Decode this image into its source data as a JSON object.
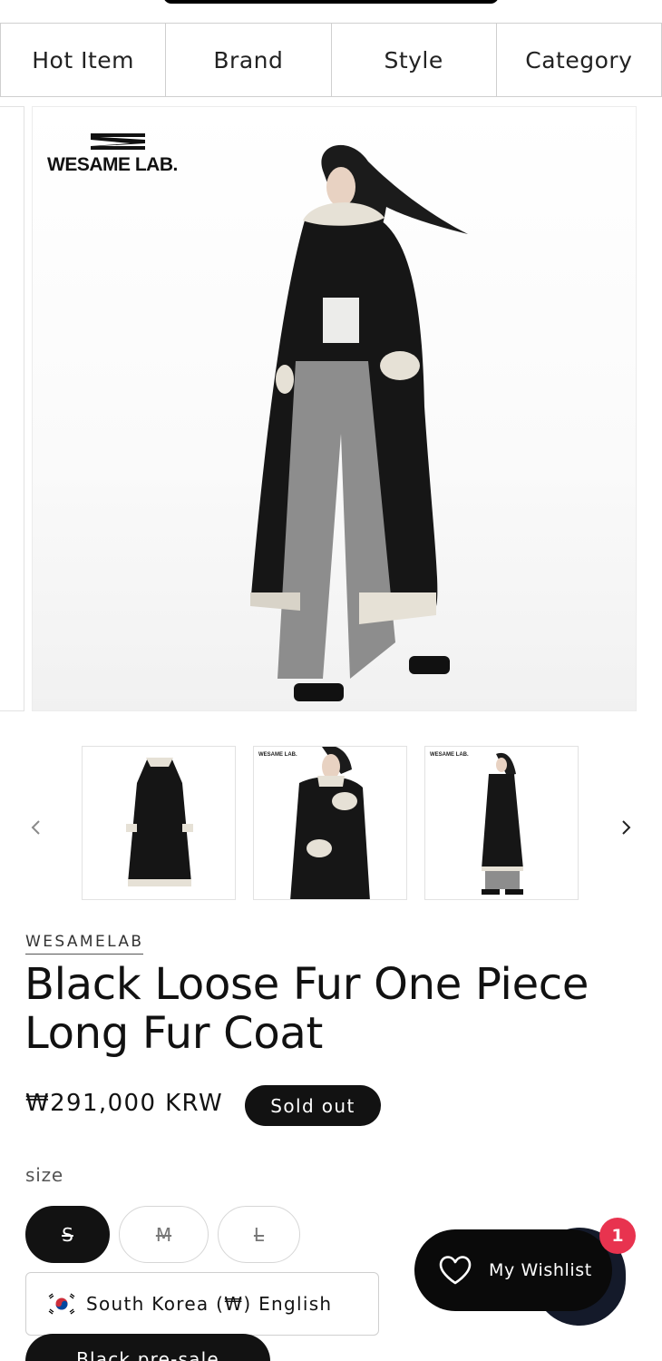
{
  "nav": {
    "items": [
      {
        "label": "Hot Item"
      },
      {
        "label": "Brand"
      },
      {
        "label": "Style"
      },
      {
        "label": "Category"
      }
    ]
  },
  "gallery": {
    "logo_text": "WESAME LAB.",
    "thumb_logo_text": "WESAME LAB.",
    "icons": {
      "prev": "chevron-left-icon",
      "next": "chevron-right-icon"
    }
  },
  "product": {
    "vendor": "WESAMELAB",
    "title": "Black Loose Fur One Piece Long Fur Coat",
    "price": "₩291,000 KRW",
    "sold_out_label": "Sold out"
  },
  "size": {
    "label": "size",
    "options": [
      {
        "label": "S",
        "selected": true,
        "available": false
      },
      {
        "label": "M",
        "selected": false,
        "available": false
      },
      {
        "label": "L",
        "selected": false,
        "available": false
      }
    ]
  },
  "locale": {
    "text": "South Korea (₩) English",
    "flag_icon": "south-korea-flag-icon"
  },
  "preorder": {
    "label": "Black pre-sale"
  },
  "wishlist": {
    "label": "My Wishlist",
    "count": "1",
    "icon": "heart-icon"
  },
  "colors": {
    "primary": "#121212",
    "badge_red": "#e8334f",
    "border": "#cfcfcf"
  }
}
